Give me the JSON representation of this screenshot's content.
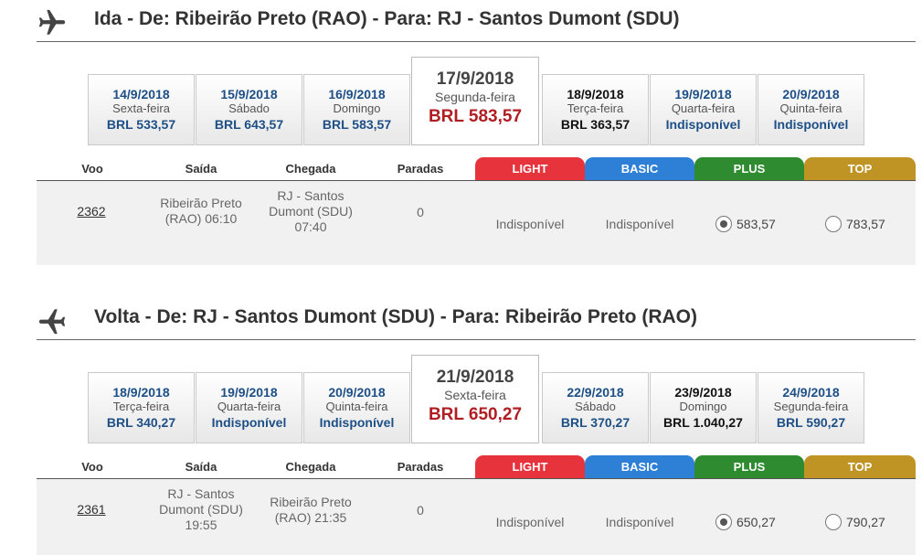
{
  "ida": {
    "title": "Ida - De: Ribeirão Preto (RAO) - Para: RJ - Santos Dumont (SDU)",
    "dates": [
      {
        "date": "14/9/2018",
        "day": "Sexta-feira",
        "price": "BRL 533,57"
      },
      {
        "date": "15/9/2018",
        "day": "Sábado",
        "price": "BRL 643,57"
      },
      {
        "date": "16/9/2018",
        "day": "Domingo",
        "price": "BRL 583,57"
      },
      {
        "date": "17/9/2018",
        "day": "Segunda-feira",
        "price": "BRL 583,57"
      },
      {
        "date": "18/9/2018",
        "day": "Terça-feira",
        "price": "BRL 363,57"
      },
      {
        "date": "19/9/2018",
        "day": "Quarta-feira",
        "price": "Indisponível"
      },
      {
        "date": "20/9/2018",
        "day": "Quinta-feira",
        "price": "Indisponível"
      }
    ],
    "headers": {
      "voo": "Voo",
      "saida": "Saída",
      "chegada": "Chegada",
      "paradas": "Paradas",
      "light": "LIGHT",
      "basic": "BASIC",
      "plus": "PLUS",
      "top": "TOP"
    },
    "flight": {
      "number": "2362",
      "departure_line1": "Ribeirão Preto",
      "departure_line2": "(RAO) 06:10",
      "departure_line3": "",
      "arrival_line1": "RJ - Santos",
      "arrival_line2": "Dumont (SDU)",
      "arrival_line3": "07:40",
      "stops": "0",
      "light": "Indisponível",
      "basic": "Indisponível",
      "plus": "583,57",
      "top": "783,57"
    }
  },
  "volta": {
    "title": "Volta - De: RJ - Santos Dumont (SDU) - Para: Ribeirão Preto (RAO)",
    "dates": [
      {
        "date": "18/9/2018",
        "day": "Terça-feira",
        "price": "BRL 340,27"
      },
      {
        "date": "19/9/2018",
        "day": "Quarta-feira",
        "price": "Indisponível"
      },
      {
        "date": "20/9/2018",
        "day": "Quinta-feira",
        "price": "Indisponível"
      },
      {
        "date": "21/9/2018",
        "day": "Sexta-feira",
        "price": "BRL 650,27"
      },
      {
        "date": "22/9/2018",
        "day": "Sábado",
        "price": "BRL 370,27"
      },
      {
        "date": "23/9/2018",
        "day": "Domingo",
        "price": "BRL 1.040,27"
      },
      {
        "date": "24/9/2018",
        "day": "Segunda-feira",
        "price": "BRL 590,27"
      }
    ],
    "headers": {
      "voo": "Voo",
      "saida": "Saída",
      "chegada": "Chegada",
      "paradas": "Paradas",
      "light": "LIGHT",
      "basic": "BASIC",
      "plus": "PLUS",
      "top": "TOP"
    },
    "flight": {
      "number": "2361",
      "departure_line1": "RJ - Santos",
      "departure_line2": "Dumont (SDU)",
      "departure_line3": "19:55",
      "arrival_line1": "Ribeirão Preto",
      "arrival_line2": "(RAO) 21:35",
      "arrival_line3": "",
      "stops": "0",
      "light": "Indisponível",
      "basic": "Indisponível",
      "plus": "650,27",
      "top": "790,27"
    }
  },
  "icons": {
    "ida": "plane-departure-icon",
    "volta": "plane-return-icon"
  },
  "colors": {
    "light": "#e7333c",
    "basic": "#2e7fd6",
    "plus": "#2e8b30",
    "top": "#bf9424",
    "selected_price": "#b01e23",
    "date_blue": "#1d4f86"
  }
}
